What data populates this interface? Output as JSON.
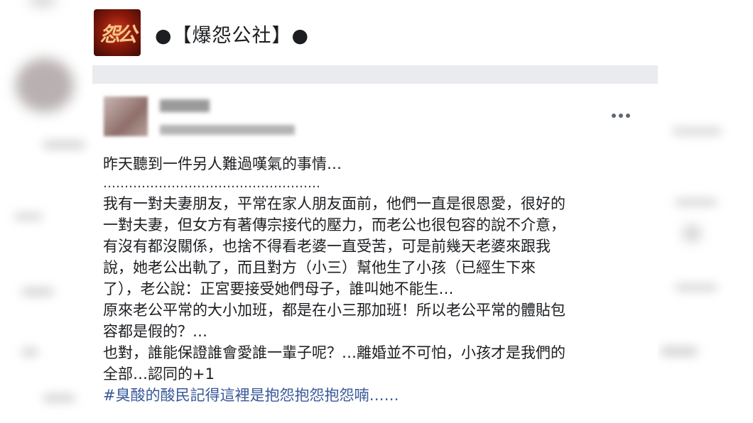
{
  "group": {
    "name": "●【爆怨公社】●",
    "logo_text": "怨公"
  },
  "post": {
    "more_icon": "more-horizontal-icon",
    "intro": "昨天聽到一件另人難過嘆氣的事情…",
    "dots": "……………………………………………",
    "body": "我有一對夫妻朋友，平常在家人朋友面前，他們一直是很恩愛，很好的\n一對夫妻，但女方有著傳宗接代的壓力，而老公也很包容的說不介意，\n有沒有都沒關係，也捨不得看老婆一直受苦，可是前幾天老婆來跟我\n說，她老公出軌了，而且對方（小三）幫他生了小孩（已經生下來\n了），老公說：正宮要接受她們母子，誰叫她不能生…\n原來老公平常的大小加班，都是在小三那加班！所以老公平常的體貼包\n容都是假的？…\n也對，誰能保證誰會愛誰一輩子呢？…離婚並不可怕，小孩才是我們的\n全部…認同的+1",
    "hashtag": "#臭酸的酸民記得這裡是抱怨抱怨抱怨喃……"
  },
  "colors": {
    "hashtag": "#385898",
    "divider": "#e9ebee",
    "text": "#1c1e21"
  }
}
